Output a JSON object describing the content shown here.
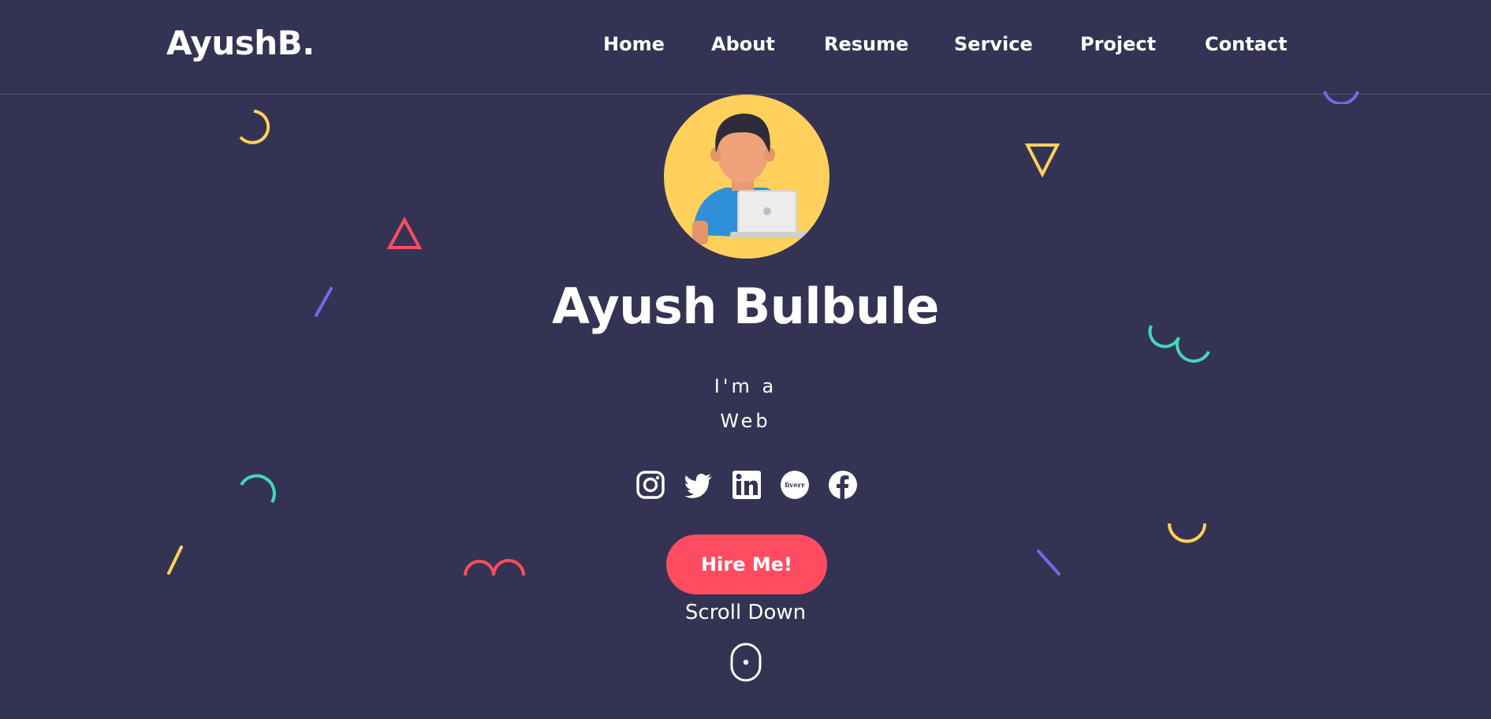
{
  "header": {
    "logo": "AyushB.",
    "nav": [
      {
        "label": "Home"
      },
      {
        "label": "About"
      },
      {
        "label": "Resume"
      },
      {
        "label": "Service"
      },
      {
        "label": "Project"
      },
      {
        "label": "Contact"
      }
    ]
  },
  "hero": {
    "avatar_icon": "developer-avatar",
    "name": "Ayush Bulbule",
    "tagline_line1": "I'm a",
    "tagline_line2": "Web",
    "social_icons": [
      "instagram-icon",
      "twitter-icon",
      "linkedin-icon",
      "fiverr-icon",
      "facebook-icon"
    ],
    "fiverr_text": "fiverr",
    "hire_button": "Hire Me!",
    "scroll_label": "Scroll Down",
    "scroll_icon": "mouse-scroll-icon"
  },
  "colors": {
    "background": "#353353",
    "accent_red": "#ff4c60",
    "accent_yellow": "#ffd15c",
    "accent_teal": "#44d7b6",
    "accent_purple": "#6c6ce5"
  }
}
